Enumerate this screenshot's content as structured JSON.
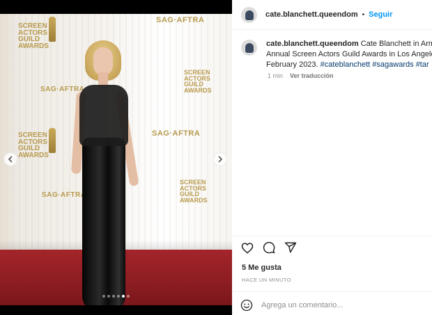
{
  "post": {
    "username": "cate.blanchett.queendom",
    "follow_label": "Seguir",
    "separator": "•"
  },
  "caption": {
    "username": "cate.blanchett.queendom",
    "line1_text": "Cate Blanchett in Armar",
    "line2_text": "Annual Screen Actors Guild Awards in Los Angeles",
    "line3_text": "February 2023.",
    "hashtags": [
      "#cateblanchett",
      "#sagawards",
      "#tar"
    ],
    "time": "1 min",
    "translate_label": "Ver traducción"
  },
  "engagement": {
    "likes": "5 Me gusta",
    "timestamp": "HACE UN MINUTO"
  },
  "comment": {
    "placeholder": "Agrega un comentario..."
  },
  "media": {
    "backdrop_text": {
      "screen_logo": [
        "SCREEN",
        "ACTORS",
        "GUILD",
        "AWARDS"
      ],
      "union_logo": "SAG·AFTRA"
    },
    "carousel": {
      "dot_count": 6,
      "active_index": 4
    },
    "prev_icon": "chevron-left-icon",
    "next_icon": "chevron-right-icon"
  },
  "icons": {
    "like": "heart-icon",
    "comment": "comment-icon",
    "share": "send-icon",
    "emoji": "smiley-icon"
  },
  "colors": {
    "accent": "#0095f6",
    "hashtag": "#00376b",
    "carpet": "#8c1d22",
    "gold": "#b89a4d"
  }
}
